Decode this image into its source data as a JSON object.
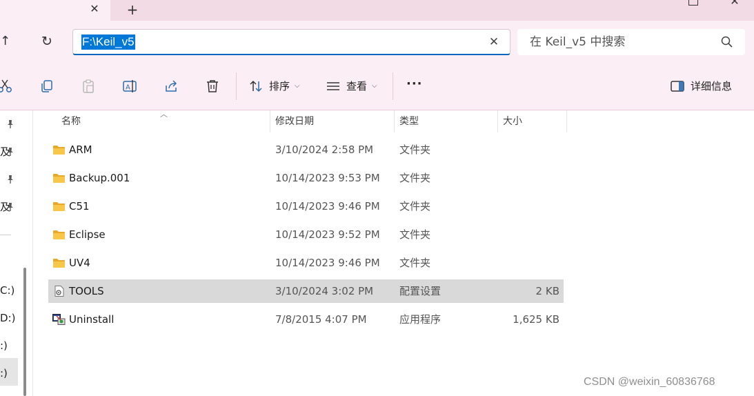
{
  "address": {
    "path": "F:\\Keil_v5"
  },
  "search": {
    "placeholder": "在 Keil_v5 中搜索"
  },
  "toolbar": {
    "sort_label": "排序",
    "view_label": "查看",
    "more_label": "···",
    "details_label": "详细信息"
  },
  "sidebar": {
    "fragments": [
      "及",
      "及",
      "C:)",
      "D:)",
      ":)",
      ":)"
    ]
  },
  "columns": {
    "name": "名称",
    "date": "修改日期",
    "type": "类型",
    "size": "大小"
  },
  "files": [
    {
      "name": "ARM",
      "date": "3/10/2024 2:58 PM",
      "type": "文件夹",
      "size": "",
      "icon": "folder-icon",
      "selected": false
    },
    {
      "name": "Backup.001",
      "date": "10/14/2023 9:53 PM",
      "type": "文件夹",
      "size": "",
      "icon": "folder-icon",
      "selected": false
    },
    {
      "name": "C51",
      "date": "10/14/2023 9:46 PM",
      "type": "文件夹",
      "size": "",
      "icon": "folder-icon",
      "selected": false
    },
    {
      "name": "Eclipse",
      "date": "10/14/2023 9:52 PM",
      "type": "文件夹",
      "size": "",
      "icon": "folder-icon",
      "selected": false
    },
    {
      "name": "UV4",
      "date": "10/14/2023 9:46 PM",
      "type": "文件夹",
      "size": "",
      "icon": "folder-icon",
      "selected": false
    },
    {
      "name": "TOOLS",
      "date": "3/10/2024 3:02 PM",
      "type": "配置设置",
      "size": "2 KB",
      "icon": "config-file-icon",
      "selected": true
    },
    {
      "name": "Uninstall",
      "date": "7/8/2015 4:07 PM",
      "type": "应用程序",
      "size": "1,625 KB",
      "icon": "application-icon",
      "selected": false
    }
  ],
  "watermark": "CSDN @weixin_60836768",
  "colors": {
    "accent": "#0078d7",
    "titlebar": "#f3dbe6",
    "toolbar": "#fbeef4",
    "folder": "#f8c74a",
    "selection": "#d9d9d9"
  }
}
